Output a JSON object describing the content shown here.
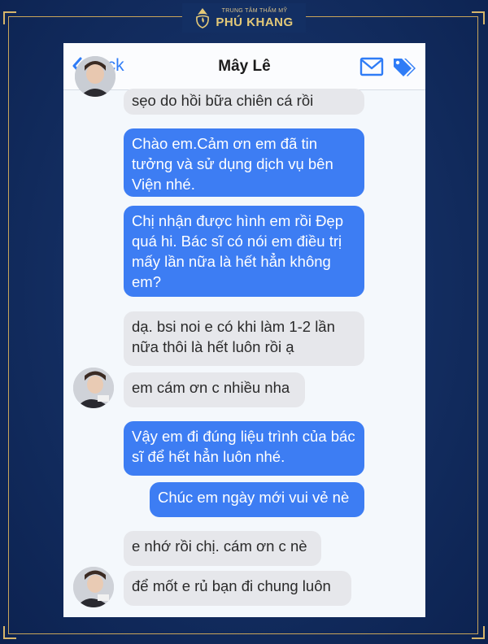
{
  "brand": {
    "subtitle": "TRUNG TÂM THẨM MỸ",
    "name": "PHÚ KHANG",
    "accent_color": "#d7b56a"
  },
  "header": {
    "back_label": "Back",
    "contact_name": "Mây Lê",
    "icons": [
      "chevron-left-icon",
      "mail-icon",
      "tags-icon"
    ],
    "accent_color": "#2f7cf6"
  },
  "messages": [
    {
      "direction": "incoming",
      "text": "sẹo do hồi bữa chiên cá rồi"
    },
    {
      "direction": "outgoing",
      "text": "Chào em.Cảm ơn em đã tin tưởng và sử dụng dịch vụ bên Viện nhé."
    },
    {
      "direction": "outgoing",
      "text": "Chị nhận được hình em rồi Đẹp quá hi. Bác sĩ có nói em điều trị mấy lần nữa là hết hẳn không em?"
    },
    {
      "direction": "incoming",
      "text": "dạ. bsi noi e có khi làm 1-2 lần nữa thôi là hết luôn rồi ạ"
    },
    {
      "direction": "incoming",
      "text": "em cám ơn c nhiều nha"
    },
    {
      "direction": "outgoing",
      "text": "Vậy em đi đúng liệu trình của bác sĩ để hết hẳn luôn nhé."
    },
    {
      "direction": "outgoing",
      "text": "Chúc em ngày mới vui vẻ nè"
    },
    {
      "direction": "incoming",
      "text": "e nhớ rồi chị. cám ơn c nè"
    },
    {
      "direction": "incoming",
      "text": "để mốt e rủ bạn đi chung luôn"
    }
  ],
  "colors": {
    "outgoing_bubble": "#3d7df3",
    "incoming_bubble": "#e6e7eb",
    "background": "#142f63"
  }
}
